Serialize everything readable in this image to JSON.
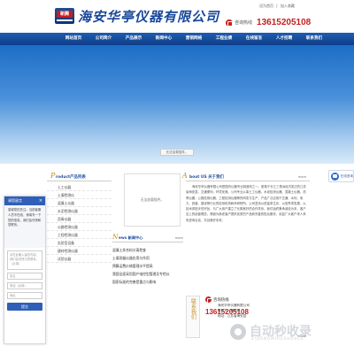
{
  "header": {
    "logo_badge": "新腾",
    "company_name": "海安华亭仪器有限公司",
    "top_links": [
      "设为首页",
      "|",
      "加入收藏"
    ],
    "hotline_label": "咨询热线",
    "hotline_number": "13615205108"
  },
  "nav": {
    "items": [
      "网站首页",
      "公司简介",
      "产品展示",
      "新闻中心",
      "营销网络",
      "工程业绩",
      "在线留言",
      "人才招聘",
      "联系我们"
    ]
  },
  "banner": {
    "caption": "无法加载插件。"
  },
  "products": {
    "title_big": "P",
    "title_rest": "roduct产品列表",
    "items": [
      "土工仪器",
      "土壤检测仪",
      "混凝土仪器",
      "水泥检测仪器",
      "沥青仪器",
      "公路检测仪器",
      "工程检测仪器",
      "实验室设备",
      "建材检测仪器",
      "试验仪器"
    ]
  },
  "image_placeholder": "无法加载插件。",
  "news": {
    "title_big": "N",
    "title_rest": "ews 新闻中心",
    "more": "more",
    "items": [
      "混凝土拌合料分离检查",
      "土壤测量仪器应用与作用",
      "预算运费价格管理水平提高",
      "我国全面采用国产电控型管理及专检仪",
      "国家标准的完善是重点与影响"
    ]
  },
  "about": {
    "title_big": "A",
    "title_rest": "bout US 关于我们",
    "more": "more",
    "text": "海安华亭仪器有限公司是国内仪器专业制造商之一。座落于长江三角洲经济发达的江苏省海安县，交通便利，环境优美。公司专业从事土工仪器、水泥检测仪器、混凝土仪器、沥青仪器、公路检测仪器、工程检测仪器等的研发与生产，产品广泛应用于交通、水利、电力、铁道、建设等行业的检测机构和科研院所。公司坚持以质量求生存，以信誉求发展，以技术求进步的宗旨，与广大用户建立了长期良好的合作关系。我们始终秉承诚信为本、客户至上的经营理念，竭诚为新老客户提供优质的产品和完善的售后服务，欢迎广大客户来人来电咨询洽谈，共创美好未来。"
  },
  "contact": {
    "side_text": "联系我们",
    "hotline_label": "咨询热线",
    "number": "13615205108",
    "info_lines": [
      "海安华亭仪器有限公司",
      "联系人：蒋经理",
      "地址：江苏省海安县"
    ]
  },
  "watermark": {
    "text": "自动秒收录",
    "sub": "ZIDONGMIAOSHOULU"
  },
  "footer": {
    "more": "more"
  },
  "chat": {
    "title": "请您留言",
    "close": "×",
    "message": "感谢您的关注，当前客服人员不在线，请填写一下您的信息，我们会尽快和您联系。",
    "field_placeholder": "请在此输入留言内容，我们会尽快与您联系。（必填）",
    "name_placeholder": "姓名",
    "phone_placeholder": "电话（必填）",
    "address_placeholder": "地址",
    "submit": "提交"
  },
  "consult": {
    "label": "在线咨询"
  }
}
